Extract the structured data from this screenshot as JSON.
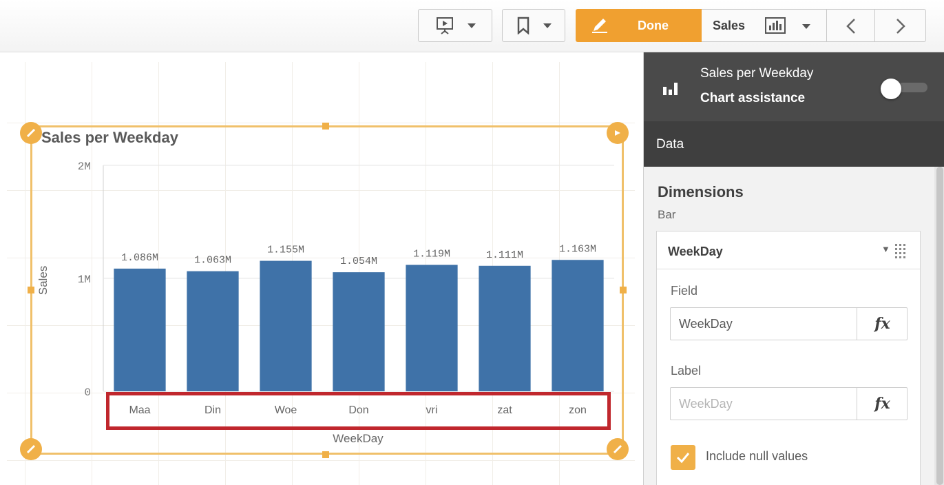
{
  "toolbar": {
    "done_label": "Done",
    "sheet_label": "Sales",
    "accent_color": "#f0a030"
  },
  "chart": {
    "title": "Sales per Weekday",
    "xlabel": "WeekDay",
    "ylabel": "Sales",
    "bar_color": "#3f72a8"
  },
  "chart_data": {
    "type": "bar",
    "title": "Sales per Weekday",
    "xlabel": "WeekDay",
    "ylabel": "Sales",
    "categories": [
      "Maa",
      "Din",
      "Woe",
      "Don",
      "vri",
      "zat",
      "zon"
    ],
    "values": [
      1086000,
      1063000,
      1155000,
      1054000,
      1119000,
      1111000,
      1163000
    ],
    "value_labels": [
      "1.086M",
      "1.063M",
      "1.155M",
      "1.054M",
      "1.119M",
      "1.111M",
      "1.163M"
    ],
    "ylim": [
      0,
      2000000
    ],
    "yticks": [
      0,
      1000000,
      2000000
    ],
    "ytick_labels": [
      "0",
      "1M",
      "2M"
    ],
    "grid": true
  },
  "panel": {
    "chart_name": "Sales per Weekday",
    "assistance_label": "Chart assistance",
    "assistance_on": false,
    "data_tab": "Data",
    "dimensions_heading": "Dimensions",
    "dimensions_sub": "Bar",
    "dimension": {
      "name": "WeekDay",
      "field_label": "Field",
      "field_value": "WeekDay",
      "label_label": "Label",
      "label_placeholder": "WeekDay",
      "fx_text": "fx",
      "include_null_label": "Include null values",
      "include_null_checked": true
    }
  }
}
